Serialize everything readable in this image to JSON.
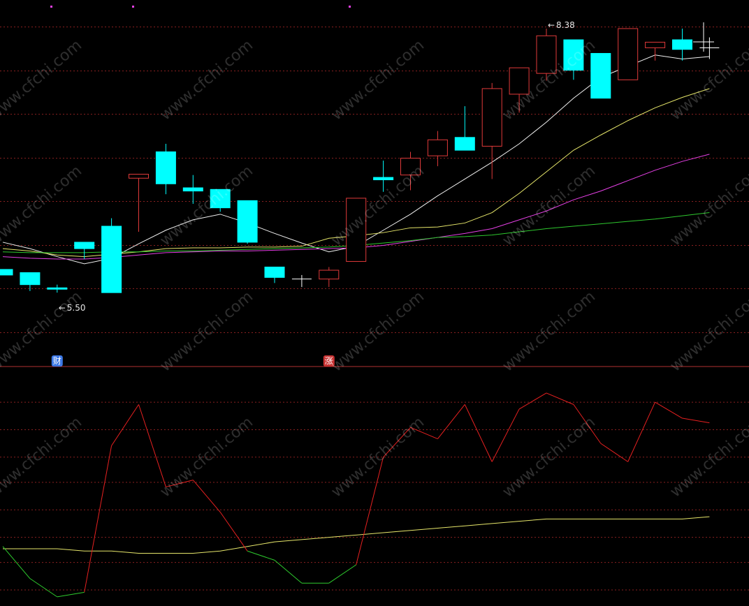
{
  "chart_data": {
    "type": "candlestick",
    "main": {
      "y_range": [
        4.2,
        8.65
      ],
      "grid_levels": [
        8.4,
        7.85,
        7.31,
        6.76,
        6.22,
        5.67,
        5.13,
        4.58
      ],
      "candles": [
        {
          "o": 5.37,
          "h": 5.37,
          "l": 5.3,
          "c": 5.3
        },
        {
          "o": 5.33,
          "h": 5.33,
          "l": 5.1,
          "c": 5.18
        },
        {
          "o": 5.14,
          "h": 5.18,
          "l": 5.08,
          "c": 5.13
        },
        {
          "o": 5.71,
          "h": 5.71,
          "l": 5.5,
          "c": 5.63
        },
        {
          "o": 5.91,
          "h": 6.01,
          "l": 5.08,
          "c": 5.08
        },
        {
          "o": 6.51,
          "h": 6.53,
          "l": 5.84,
          "c": 6.56
        },
        {
          "o": 6.84,
          "h": 6.94,
          "l": 6.31,
          "c": 6.44
        },
        {
          "o": 6.39,
          "h": 6.55,
          "l": 6.19,
          "c": 6.35
        },
        {
          "o": 6.37,
          "h": 6.37,
          "l": 6.09,
          "c": 6.14
        },
        {
          "o": 6.23,
          "h": 6.23,
          "l": 5.69,
          "c": 5.71
        },
        {
          "o": 5.4,
          "h": 5.4,
          "l": 5.2,
          "c": 5.27
        },
        {
          "o": 5.25,
          "h": 5.3,
          "l": 5.15,
          "c": 5.25
        },
        {
          "o": 5.25,
          "h": 5.4,
          "l": 5.15,
          "c": 5.36
        },
        {
          "o": 5.47,
          "h": 6.26,
          "l": 5.47,
          "c": 6.26
        },
        {
          "o": 6.52,
          "h": 6.73,
          "l": 6.34,
          "c": 6.49
        },
        {
          "o": 6.55,
          "h": 6.84,
          "l": 6.36,
          "c": 6.76
        },
        {
          "o": 6.79,
          "h": 7.1,
          "l": 6.66,
          "c": 6.99
        },
        {
          "o": 7.02,
          "h": 7.41,
          "l": 6.91,
          "c": 6.86
        },
        {
          "o": 6.91,
          "h": 7.7,
          "l": 6.5,
          "c": 7.63
        },
        {
          "o": 7.56,
          "h": 7.88,
          "l": 7.33,
          "c": 7.89
        },
        {
          "o": 7.82,
          "h": 8.38,
          "l": 7.73,
          "c": 8.29
        },
        {
          "o": 8.24,
          "h": 8.24,
          "l": 7.74,
          "c": 7.86
        },
        {
          "o": 8.07,
          "h": 8.07,
          "l": 7.51,
          "c": 7.51
        },
        {
          "o": 7.74,
          "h": 8.37,
          "l": 7.74,
          "c": 8.38
        },
        {
          "o": 8.14,
          "h": 8.18,
          "l": 7.98,
          "c": 8.21
        },
        {
          "o": 8.24,
          "h": 8.38,
          "l": 7.98,
          "c": 8.12
        },
        {
          "o": 8.14,
          "h": 8.27,
          "l": 8.0,
          "c": 8.14
        }
      ],
      "ma_lines": [
        {
          "color": "#f0f0f0",
          "values": [
            5.71,
            5.63,
            5.53,
            5.44,
            5.51,
            5.69,
            5.86,
            5.99,
            6.06,
            5.95,
            5.82,
            5.7,
            5.59,
            5.66,
            5.86,
            6.06,
            6.29,
            6.5,
            6.71,
            6.94,
            7.21,
            7.51,
            7.77,
            7.91,
            8.05,
            8.0,
            8.03
          ]
        },
        {
          "color": "#e6e66a",
          "values": [
            5.63,
            5.6,
            5.55,
            5.53,
            5.56,
            5.59,
            5.63,
            5.64,
            5.64,
            5.65,
            5.65,
            5.66,
            5.76,
            5.79,
            5.83,
            5.89,
            5.9,
            5.95,
            6.08,
            6.32,
            6.59,
            6.86,
            7.05,
            7.23,
            7.39,
            7.52,
            7.63
          ]
        },
        {
          "color": "#e640e6",
          "values": [
            5.53,
            5.51,
            5.5,
            5.5,
            5.52,
            5.55,
            5.58,
            5.59,
            5.6,
            5.6,
            5.61,
            5.62,
            5.63,
            5.64,
            5.67,
            5.72,
            5.77,
            5.82,
            5.88,
            5.99,
            6.1,
            6.24,
            6.35,
            6.48,
            6.61,
            6.72,
            6.81
          ]
        },
        {
          "color": "#2ec82e",
          "values": [
            5.59,
            5.58,
            5.58,
            5.58,
            5.59,
            5.59,
            5.6,
            5.6,
            5.61,
            5.62,
            5.63,
            5.64,
            5.65,
            5.67,
            5.7,
            5.73,
            5.77,
            5.78,
            5.8,
            5.84,
            5.88,
            5.91,
            5.94,
            5.97,
            6.0,
            6.04,
            6.08
          ]
        }
      ],
      "annotations": [
        {
          "text": "8.38",
          "index": 20,
          "value": 8.38,
          "kind": "high"
        },
        {
          "text": "5.50",
          "index": 2,
          "value": 5.08,
          "kind": "low"
        }
      ],
      "event_badges": [
        {
          "text": "财",
          "index": 2,
          "color": "#3c78e6"
        },
        {
          "text": "涨",
          "index": 12,
          "color": "#c83232"
        }
      ]
    },
    "sub": {
      "y_range": [
        0,
        100
      ],
      "grid_levels": [
        89,
        77,
        65,
        54,
        42,
        30,
        19,
        7
      ],
      "series": [
        {
          "name": "K",
          "values": [
            26,
            12,
            4,
            6,
            70,
            88,
            52,
            55,
            41,
            24,
            20,
            10,
            10,
            18,
            65,
            78,
            73,
            88,
            63,
            86,
            93,
            88,
            71,
            63,
            89,
            82,
            80
          ]
        },
        {
          "name": "D",
          "color": "#e6e66a",
          "values": [
            25,
            25,
            25,
            24,
            24,
            23,
            23,
            23,
            24,
            26,
            28,
            29,
            30,
            31,
            32,
            33,
            34,
            35,
            36,
            37,
            38,
            38,
            38,
            38,
            38,
            38,
            39
          ]
        }
      ]
    }
  },
  "watermark": "www.cfchi.com"
}
